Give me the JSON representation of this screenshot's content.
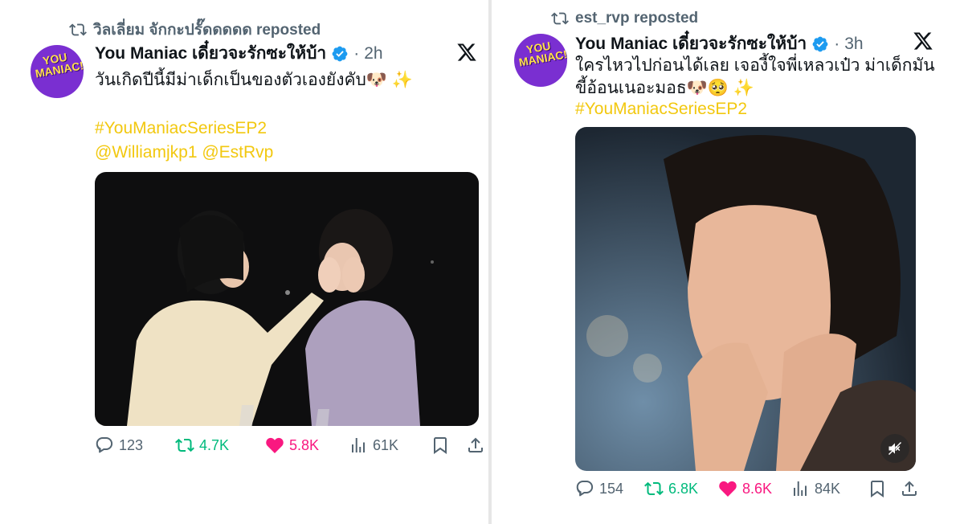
{
  "left_post": {
    "repost_text": "วิลเลี่ยม จักกะปรั๊ดดดดด reposted",
    "author_name": "You Maniac เดี๋ยวจะรักซะให้บ้า",
    "time": "2h",
    "text_line": "วันเกิดปีนี้มีม่าเด็กเป็นของตัวเองยังคับ🐶 ✨",
    "hashtag": "#YouManiacSeriesEP2",
    "mentions": "@Williamjkp1 @EstRvp",
    "stats": {
      "replies": "123",
      "reposts": "4.7K",
      "likes": "5.8K",
      "views": "61K"
    }
  },
  "right_post": {
    "repost_text": "est_rvp reposted",
    "author_name": "You Maniac เดี๋ยวจะรักซะให้บ้า",
    "time": "3h",
    "text_line1": "ใครไหวไปก่อนได้เลย เจองี้ใจพี่เหลวเป๋ว ม่าเด็กมัน",
    "text_line2": "ขี้อ้อนเนอะมอธ🐶🥺 ✨",
    "hashtag": "#YouManiacSeriesEP2",
    "stats": {
      "replies": "154",
      "reposts": "6.8K",
      "likes": "8.6K",
      "views": "84K"
    }
  },
  "avatar_logo_text": "YOU MANIAC!",
  "icons": [
    "retweet-icon",
    "verified-badge-icon",
    "x-logo-icon",
    "reply-icon",
    "like-icon",
    "views-icon",
    "bookmark-icon",
    "share-icon",
    "muted-speaker-icon"
  ],
  "colors": {
    "accent_hashtag": "#f2c80f",
    "retweet": "#00ba7c",
    "like": "#f91880",
    "verified": "#1d9bf0",
    "muted_text": "#536471"
  }
}
